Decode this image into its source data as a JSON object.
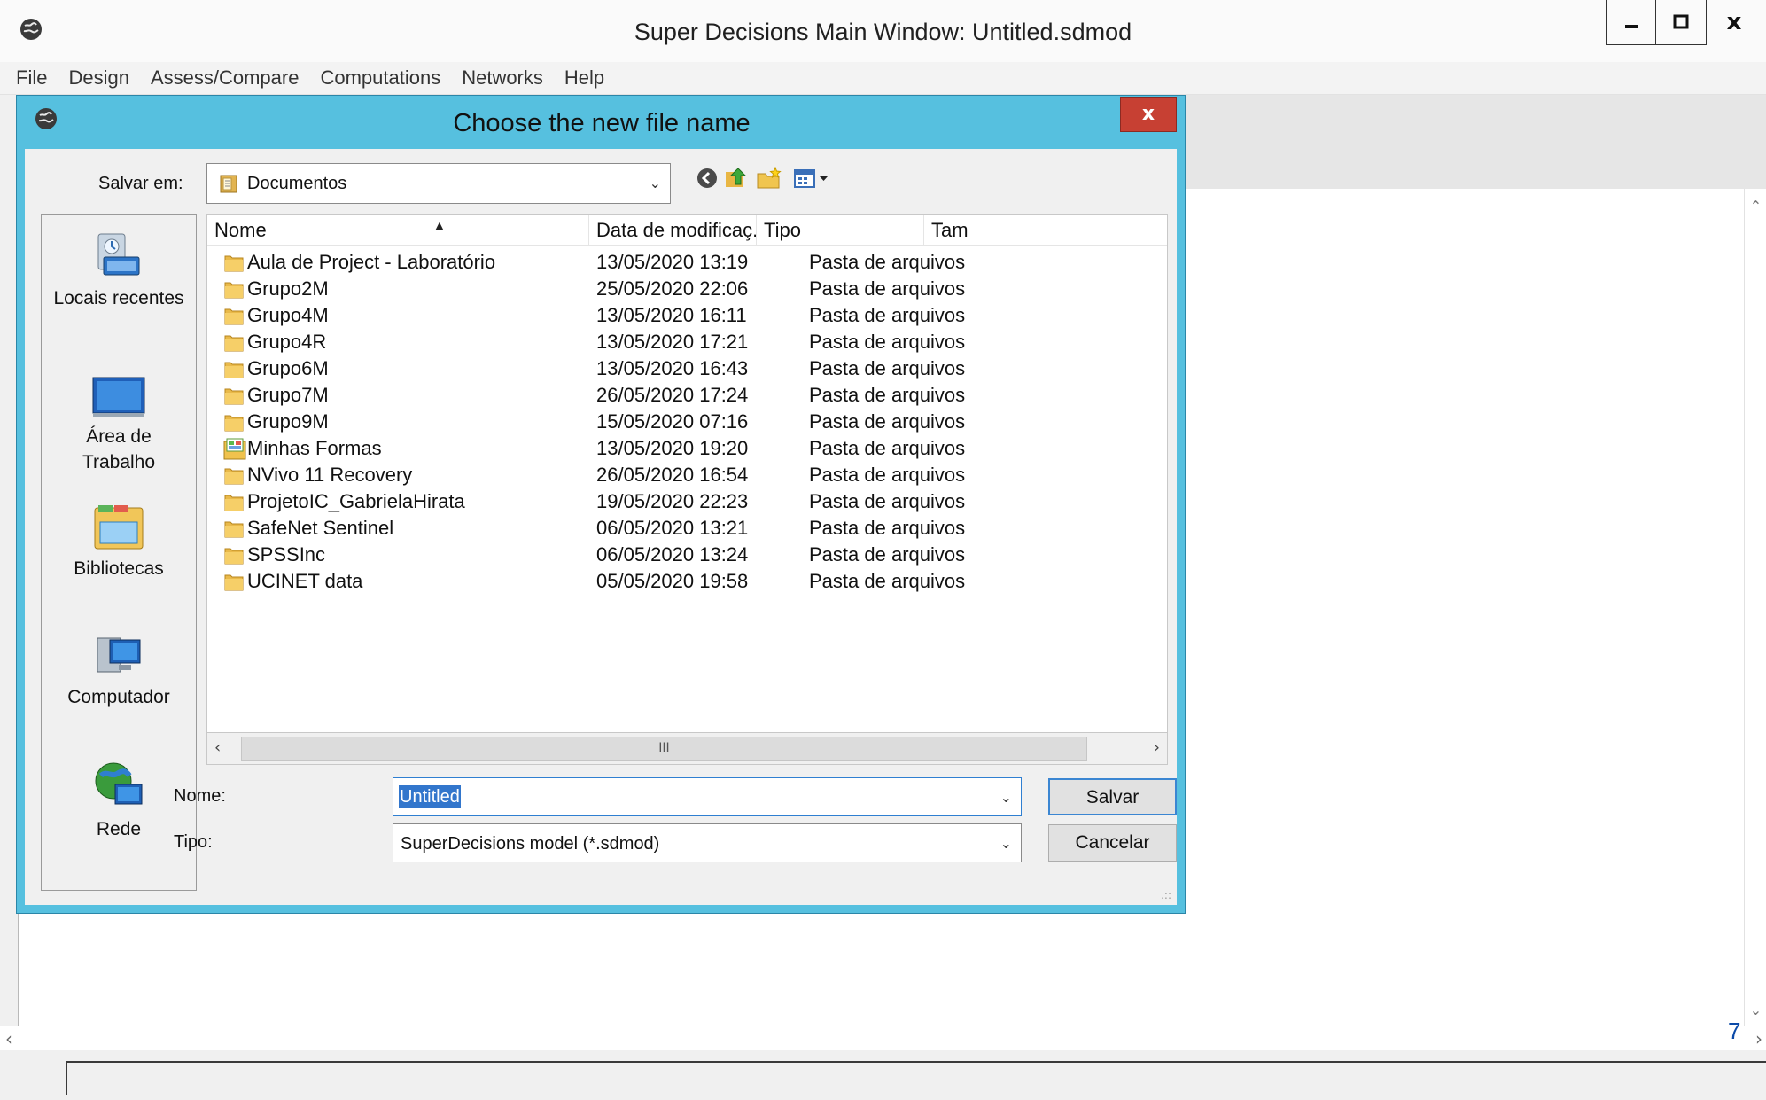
{
  "main_window": {
    "title": "Super Decisions Main Window: Untitled.sdmod",
    "controls": {
      "minimize": "‒",
      "maximize": "□",
      "close": "x"
    },
    "menu": [
      "File",
      "Design",
      "Assess/Compare",
      "Computations",
      "Networks",
      "Help"
    ],
    "page_number": "7"
  },
  "dialog": {
    "title": "Choose the new file name",
    "close_label": "x",
    "save_in": {
      "label": "Salvar em:",
      "value": "Documentos"
    },
    "places": [
      {
        "label": "Locais recentes",
        "icon": "recent-places-icon"
      },
      {
        "label": "Área de Trabalho",
        "icon": "desktop-icon"
      },
      {
        "label": "Bibliotecas",
        "icon": "libraries-icon"
      },
      {
        "label": "Computador",
        "icon": "computer-icon"
      },
      {
        "label": "Rede",
        "icon": "network-icon"
      }
    ],
    "columns": [
      "Nome",
      "Data de modificaç...",
      "Tipo",
      "Tam"
    ],
    "files": [
      {
        "name": "Aula de Project - Laboratório",
        "date": "13/05/2020 13:19",
        "type": "Pasta de arquivos",
        "icon": "folder-icon"
      },
      {
        "name": "Grupo2M",
        "date": "25/05/2020 22:06",
        "type": "Pasta de arquivos",
        "icon": "folder-icon"
      },
      {
        "name": "Grupo4M",
        "date": "13/05/2020 16:11",
        "type": "Pasta de arquivos",
        "icon": "folder-icon"
      },
      {
        "name": "Grupo4R",
        "date": "13/05/2020 17:21",
        "type": "Pasta de arquivos",
        "icon": "folder-icon"
      },
      {
        "name": "Grupo6M",
        "date": "13/05/2020 16:43",
        "type": "Pasta de arquivos",
        "icon": "folder-icon"
      },
      {
        "name": "Grupo7M",
        "date": "26/05/2020 17:24",
        "type": "Pasta de arquivos",
        "icon": "folder-icon"
      },
      {
        "name": "Grupo9M",
        "date": "15/05/2020 07:16",
        "type": "Pasta de arquivos",
        "icon": "folder-icon"
      },
      {
        "name": "Minhas Formas",
        "date": "13/05/2020 19:20",
        "type": "Pasta de arquivos",
        "icon": "shapes-folder-icon"
      },
      {
        "name": "NVivo 11 Recovery",
        "date": "26/05/2020 16:54",
        "type": "Pasta de arquivos",
        "icon": "folder-icon"
      },
      {
        "name": "ProjetoIC_GabrielaHirata",
        "date": "19/05/2020 22:23",
        "type": "Pasta de arquivos",
        "icon": "folder-icon"
      },
      {
        "name": "SafeNet Sentinel",
        "date": "06/05/2020 13:21",
        "type": "Pasta de arquivos",
        "icon": "folder-icon"
      },
      {
        "name": "SPSSInc",
        "date": "06/05/2020 13:24",
        "type": "Pasta de arquivos",
        "icon": "folder-icon"
      },
      {
        "name": "UCINET data",
        "date": "05/05/2020 19:58",
        "type": "Pasta de arquivos",
        "icon": "folder-icon"
      }
    ],
    "scroll_thumb": "III",
    "filename": {
      "label": "Nome:",
      "value": "Untitled"
    },
    "filetype": {
      "label": "Tipo:",
      "value": "SuperDecisions model (*.sdmod)"
    },
    "buttons": {
      "save": "Salvar",
      "cancel": "Cancelar"
    }
  },
  "colors": {
    "dialog_frame": "#56c0df",
    "close_button": "#c74033",
    "selection": "#3276cc",
    "page_number": "#0b4aa8"
  }
}
